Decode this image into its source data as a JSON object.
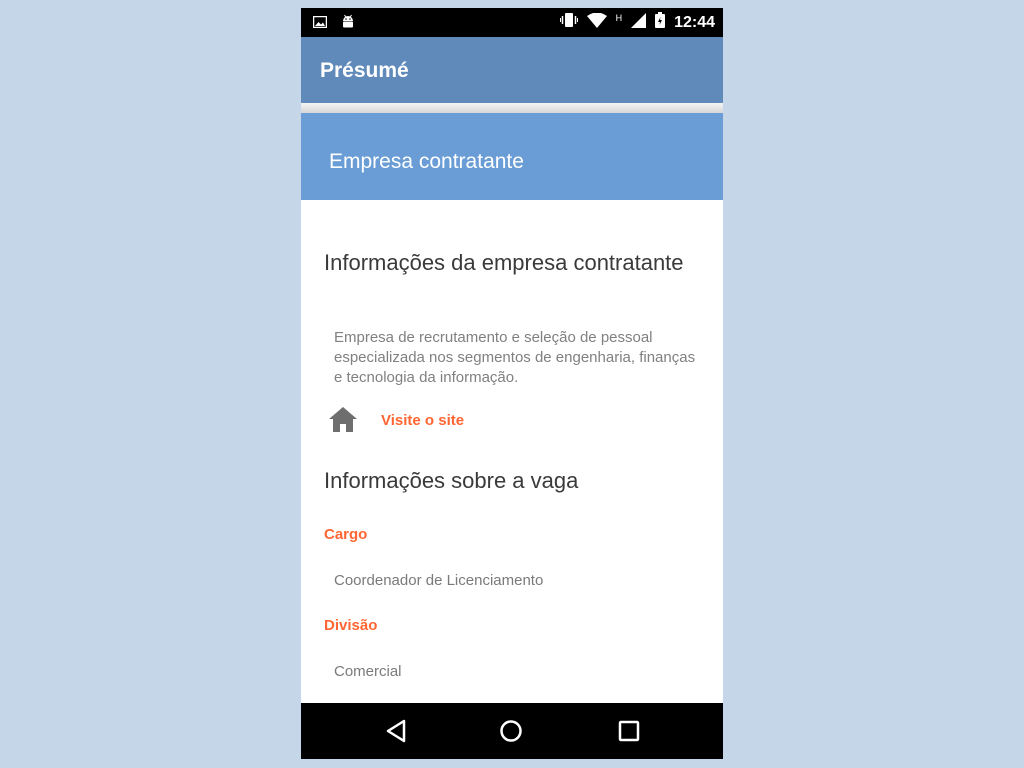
{
  "status_bar": {
    "left_icons": [
      "image-notification-icon",
      "android-notification-icon"
    ],
    "right_icons": [
      "vibrate-icon",
      "wifi-icon",
      "signal-icon",
      "battery-icon"
    ],
    "network_mark": "H",
    "time": "12:44"
  },
  "app_bar": {
    "title": "Présumé",
    "color": "#5f8ab9"
  },
  "section": {
    "title": "Empresa contratante",
    "color": "#6a9cd6"
  },
  "company": {
    "heading": "Informações da empresa contratante",
    "description": "Empresa de recrutamento e seleção de pessoal especializada nos segmentos de engenharia, finanças e tecnologia da informação.",
    "site_icon": "home-icon",
    "site_link": "Visite o site"
  },
  "job": {
    "heading": "Informações sobre a vaga",
    "fields": [
      {
        "label": "Cargo",
        "value": "Coordenador de Licenciamento"
      },
      {
        "label": "Divisão",
        "value": "Comercial"
      }
    ]
  },
  "accent_color": "#ff6633",
  "nav_bar": {
    "icons": [
      "back-icon",
      "home-circle-icon",
      "recents-icon"
    ]
  }
}
